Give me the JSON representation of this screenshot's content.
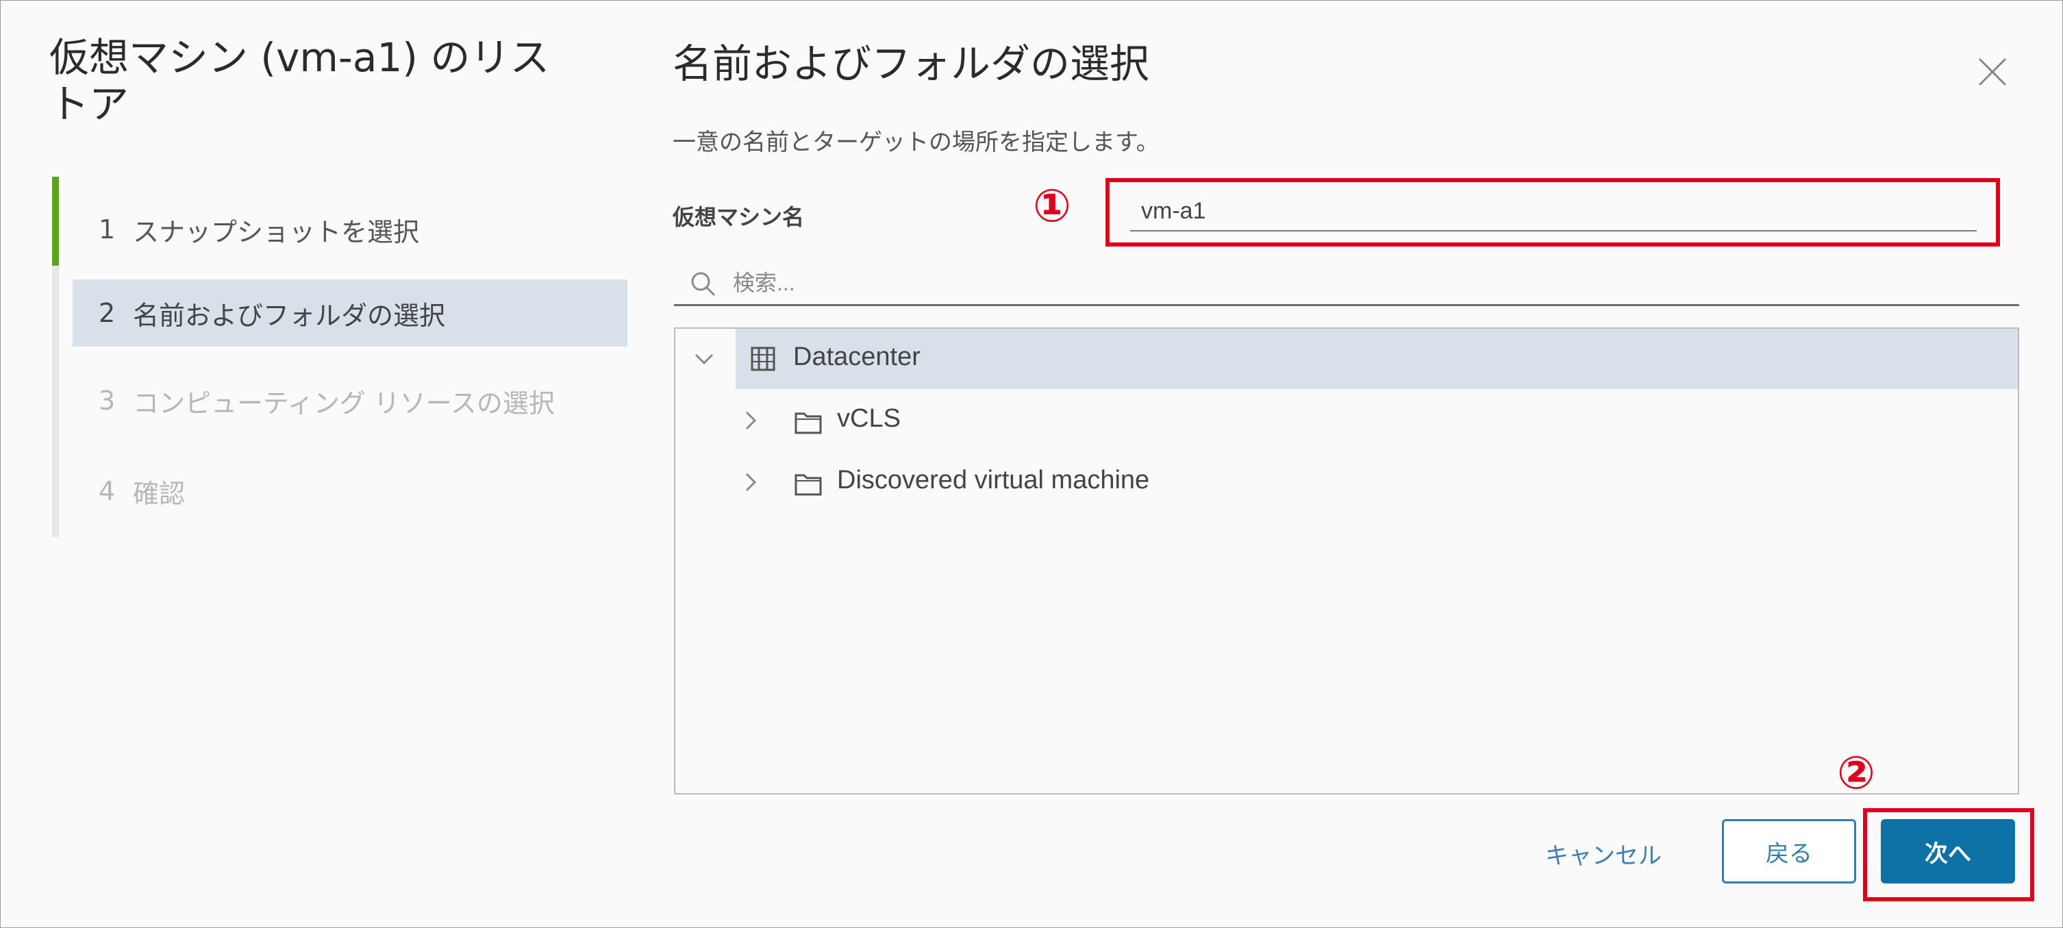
{
  "dialog": {
    "title": "仮想マシン (vm-a1) のリストア"
  },
  "steps": [
    {
      "num": "1",
      "label": "スナップショットを選択",
      "state": "done"
    },
    {
      "num": "2",
      "label": "名前およびフォルダの選択",
      "state": "current"
    },
    {
      "num": "3",
      "label": "コンピューティング リソースの選択",
      "state": "disabled"
    },
    {
      "num": "4",
      "label": "確認",
      "state": "disabled"
    }
  ],
  "panel": {
    "title": "名前およびフォルダの選択",
    "subtitle": "一意の名前とターゲットの場所を指定します。",
    "name_label": "仮想マシン名",
    "name_value": "vm-a1",
    "search_placeholder": "検索..."
  },
  "tree": [
    {
      "label": "Datacenter",
      "icon": "datacenter-icon",
      "expanded": true,
      "selected": true,
      "level": 0
    },
    {
      "label": "vCLS",
      "icon": "folder-icon",
      "expanded": false,
      "selected": false,
      "level": 1
    },
    {
      "label": "Discovered virtual machine",
      "icon": "folder-icon",
      "expanded": false,
      "selected": false,
      "level": 1
    }
  ],
  "footer": {
    "cancel_label": "キャンセル",
    "back_label": "戻る",
    "next_label": "次へ"
  },
  "annotations": {
    "marker_1": "①",
    "marker_2": "②"
  },
  "colors": {
    "accent": "#0e72a6",
    "step_active_bar": "#5ea51e",
    "selection_bg": "#d8e1e9",
    "annotation_red": "#e0001a"
  }
}
